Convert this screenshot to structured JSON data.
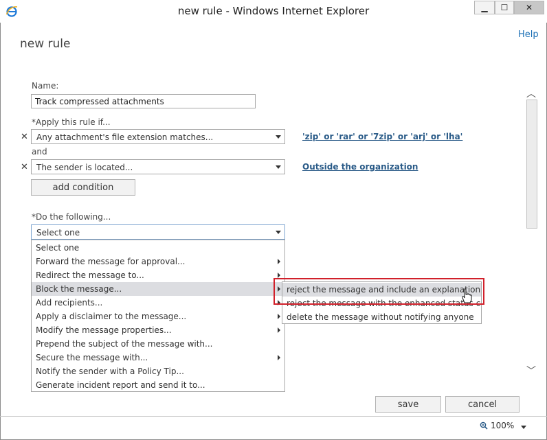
{
  "window": {
    "title": "new rule - Windows Internet Explorer",
    "minimize_glyph": "▁",
    "maximize_glyph": "☐",
    "close_glyph": "✕"
  },
  "page": {
    "title": "new rule",
    "help_label": "Help"
  },
  "form": {
    "name_label": "Name:",
    "name_value": "Track compressed attachments",
    "apply_label": "*Apply this rule if...",
    "conditions": [
      {
        "value": "Any attachment's file extension matches...",
        "link": "'zip' or 'rar' or '7zip' or 'arj' or 'lha'"
      },
      {
        "value": "The sender is located...",
        "link": "Outside the organization"
      }
    ],
    "and_label": "and",
    "add_condition_label": "add condition",
    "do_label": "*Do the following...",
    "action_selected": "Select one"
  },
  "dropdown": {
    "items": [
      {
        "label": "Select one"
      },
      {
        "label": "Forward the message for approval..."
      },
      {
        "label": "Redirect the message to..."
      },
      {
        "label": "Block the message..."
      },
      {
        "label": "Add recipients..."
      },
      {
        "label": "Apply a disclaimer to the message..."
      },
      {
        "label": "Modify the message properties..."
      },
      {
        "label": "Prepend the subject of the message with..."
      },
      {
        "label": "Secure the message with..."
      },
      {
        "label": "Notify the sender with a Policy Tip..."
      },
      {
        "label": "Generate incident report and send it to..."
      }
    ],
    "highlighted": "Block the message..."
  },
  "submenu": {
    "items": [
      {
        "label": "reject the message and include an explanation"
      },
      {
        "label": "reject the message with the enhanced status code of"
      },
      {
        "label": "delete the message without notifying anyone"
      }
    ]
  },
  "footer": {
    "save_label": "save",
    "cancel_label": "cancel"
  },
  "statusbar": {
    "zoom": "100%"
  },
  "colors": {
    "link": "#2a5b88",
    "help": "#1b6fb5",
    "highlight_box": "#d1202b",
    "hover_bg": "#dcdde1"
  }
}
